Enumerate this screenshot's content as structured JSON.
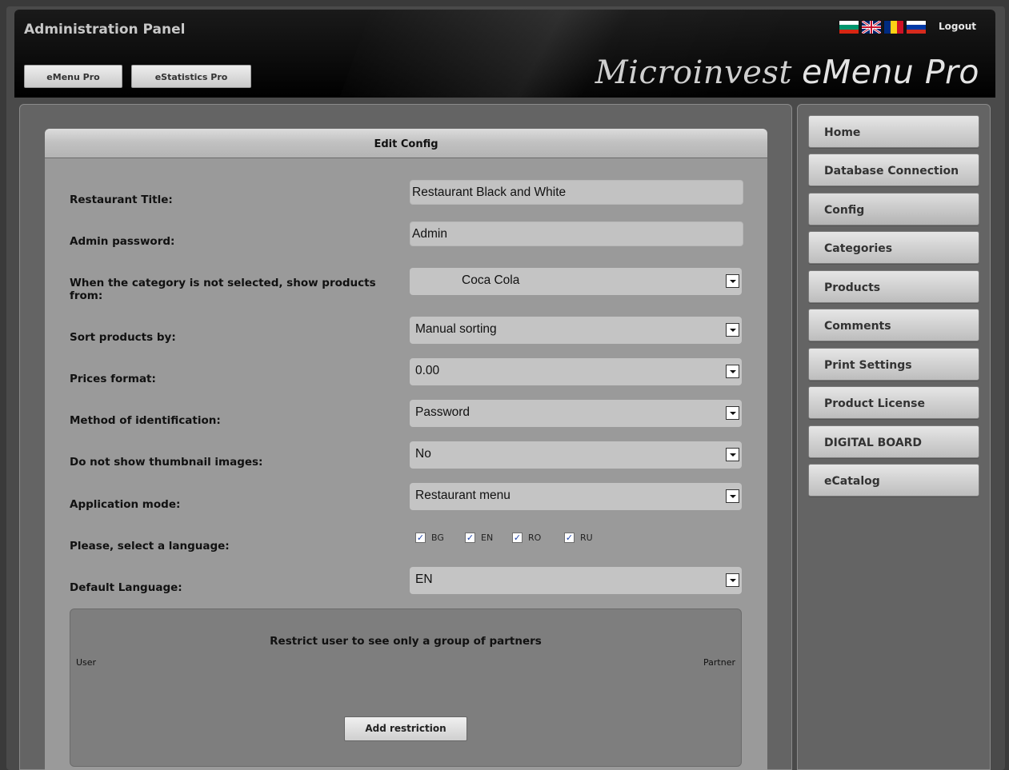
{
  "header": {
    "admin_title": "Administration Panel",
    "logout_label": "Logout",
    "brand_left": "Microinvest",
    "brand_right": "eMenu Pro",
    "top_buttons": [
      {
        "label": "eMenu Pro"
      },
      {
        "label": "eStatistics Pro"
      }
    ],
    "flags": [
      "bulgaria-flag-icon",
      "uk-flag-icon",
      "romania-flag-icon",
      "russia-flag-icon"
    ]
  },
  "panel": {
    "title": "Edit Config",
    "restaurant_title": {
      "label": "Restaurant Title:",
      "value": "Restaurant Black and White"
    },
    "admin_password": {
      "label": "Admin password:",
      "value": "Admin"
    },
    "no_category": {
      "label": "When the category is not selected, show products from:",
      "value": "Coca Cola"
    },
    "sort_products": {
      "label": "Sort products by:",
      "value": "Manual sorting"
    },
    "prices_format": {
      "label": "Prices format:",
      "value": "0.00"
    },
    "identification": {
      "label": "Method of identification:",
      "value": "Password"
    },
    "thumbnails": {
      "label": "Do not show thumbnail images:",
      "value": "No"
    },
    "app_mode": {
      "label": "Application mode:",
      "value": "Restaurant menu"
    },
    "languages": {
      "label": "Please, select a language:",
      "options": [
        {
          "code": "BG",
          "checked": true
        },
        {
          "code": "EN",
          "checked": true
        },
        {
          "code": "RO",
          "checked": true
        },
        {
          "code": "RU",
          "checked": true
        }
      ]
    },
    "default_language": {
      "label": "Default Language:",
      "value": "EN"
    },
    "restriction": {
      "title": "Restrict user to see only a group of partners",
      "col_user": "User",
      "col_partner": "Partner",
      "button": "Add restriction"
    }
  },
  "sidebar": {
    "items": [
      {
        "label": "Home"
      },
      {
        "label": "Database Connection"
      },
      {
        "label": "Config"
      },
      {
        "label": "Categories"
      },
      {
        "label": "Products"
      },
      {
        "label": "Comments"
      },
      {
        "label": "Print Settings"
      },
      {
        "label": "Product License"
      },
      {
        "label": "DIGITAL BOARD"
      },
      {
        "label": "eCatalog"
      }
    ]
  },
  "colors": {
    "background": "#4a4a4a",
    "panel": "#9a9a9a",
    "sidebar": "#646464",
    "header": "#0b0b0b"
  }
}
